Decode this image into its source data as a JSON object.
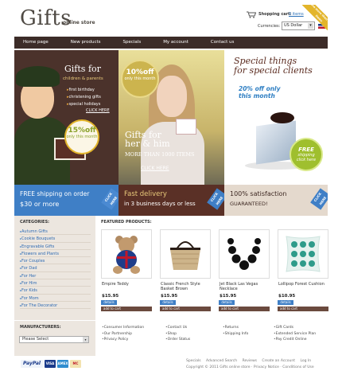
{
  "header": {
    "logo": "Gifts",
    "logo_sub": "online store",
    "cart_label": "Shopping cart:",
    "cart_count": "0 items",
    "currency_label": "Currencies:",
    "currency_value": "US Dollar",
    "ribbon_text": "Save more than 50000 items"
  },
  "nav": [
    "Home page",
    "New products",
    "Specials",
    "My account",
    "Contact us"
  ],
  "banners": {
    "b1": {
      "title": "Gifts for",
      "sub": "children & parents",
      "items": [
        "first birthday",
        "christening gifts",
        "special holidays"
      ],
      "link": "CLICK HERE",
      "badge_pct": "15%off",
      "badge_sub": "only this month"
    },
    "b2": {
      "badge_pct": "10%off",
      "badge_sub": "only this month",
      "line1": "Gifts for",
      "line2": "her & him",
      "line3": "MORE THAN 1000 ITEMS",
      "link": "CLICK HERE"
    },
    "b3": {
      "line1": "Special things",
      "line2": "for special clients",
      "line3": "20% off only",
      "line4": "this month",
      "badge_main": "FREE",
      "badge_sub": "shipping",
      "badge_link": "click here"
    }
  },
  "strip": {
    "s1_line1": "FREE shipping on order",
    "s1_line2": "$30 or more",
    "s2_line1": "Fast delivery",
    "s2_line2": "in 3 business days or less",
    "s3_line1": "100% satisfaction",
    "s3_line2": "GUARANTEED!",
    "click_tag": "CLICK HERE"
  },
  "categories": {
    "heading": "CATEGORIES:",
    "items": [
      "Autumn Gifts",
      "Cookie Bouquets",
      "Engravable Gifts",
      "Flowers and Plants",
      "For Couples",
      "For Dad",
      "For Her",
      "For Him",
      "For Kids",
      "For Mom",
      "For The Decorator"
    ]
  },
  "featured": {
    "heading": "FEATURED PRODUCTS:",
    "details_label": "details",
    "cart_label": "add to cart",
    "products": [
      {
        "name": "Empire Teddy",
        "price": "$15.95"
      },
      {
        "name": "Classic French Style Basket Brown",
        "price": "$15.95"
      },
      {
        "name": "Jet Black Las Vegas Necklace",
        "price": "$15.95"
      },
      {
        "name": "Lollipop Forest Cushion",
        "price": "$10.95"
      }
    ]
  },
  "manufacturers": {
    "heading": "MANUFACTURERS:",
    "select_value": "Please Select"
  },
  "footer_cols": [
    [
      "Consumer Information",
      "Our Partnership",
      "Privacy Policy"
    ],
    [
      "Contact Us",
      "Shop",
      "Order Status"
    ],
    [
      "Returns",
      "Shipping Info"
    ],
    [
      "Gift Cards",
      "Extended Service Plan",
      "Pay Credit Online"
    ]
  ],
  "bottom_links": [
    "Specials",
    "Advanced Search",
    "Reviews",
    "Create an Account",
    "Log In"
  ],
  "copyright": "Copyright © 2011 Gifts online store · Privacy Notice · Conditions of Use",
  "payments": [
    "PayPal",
    "VISA",
    "AMEX",
    "MC"
  ]
}
